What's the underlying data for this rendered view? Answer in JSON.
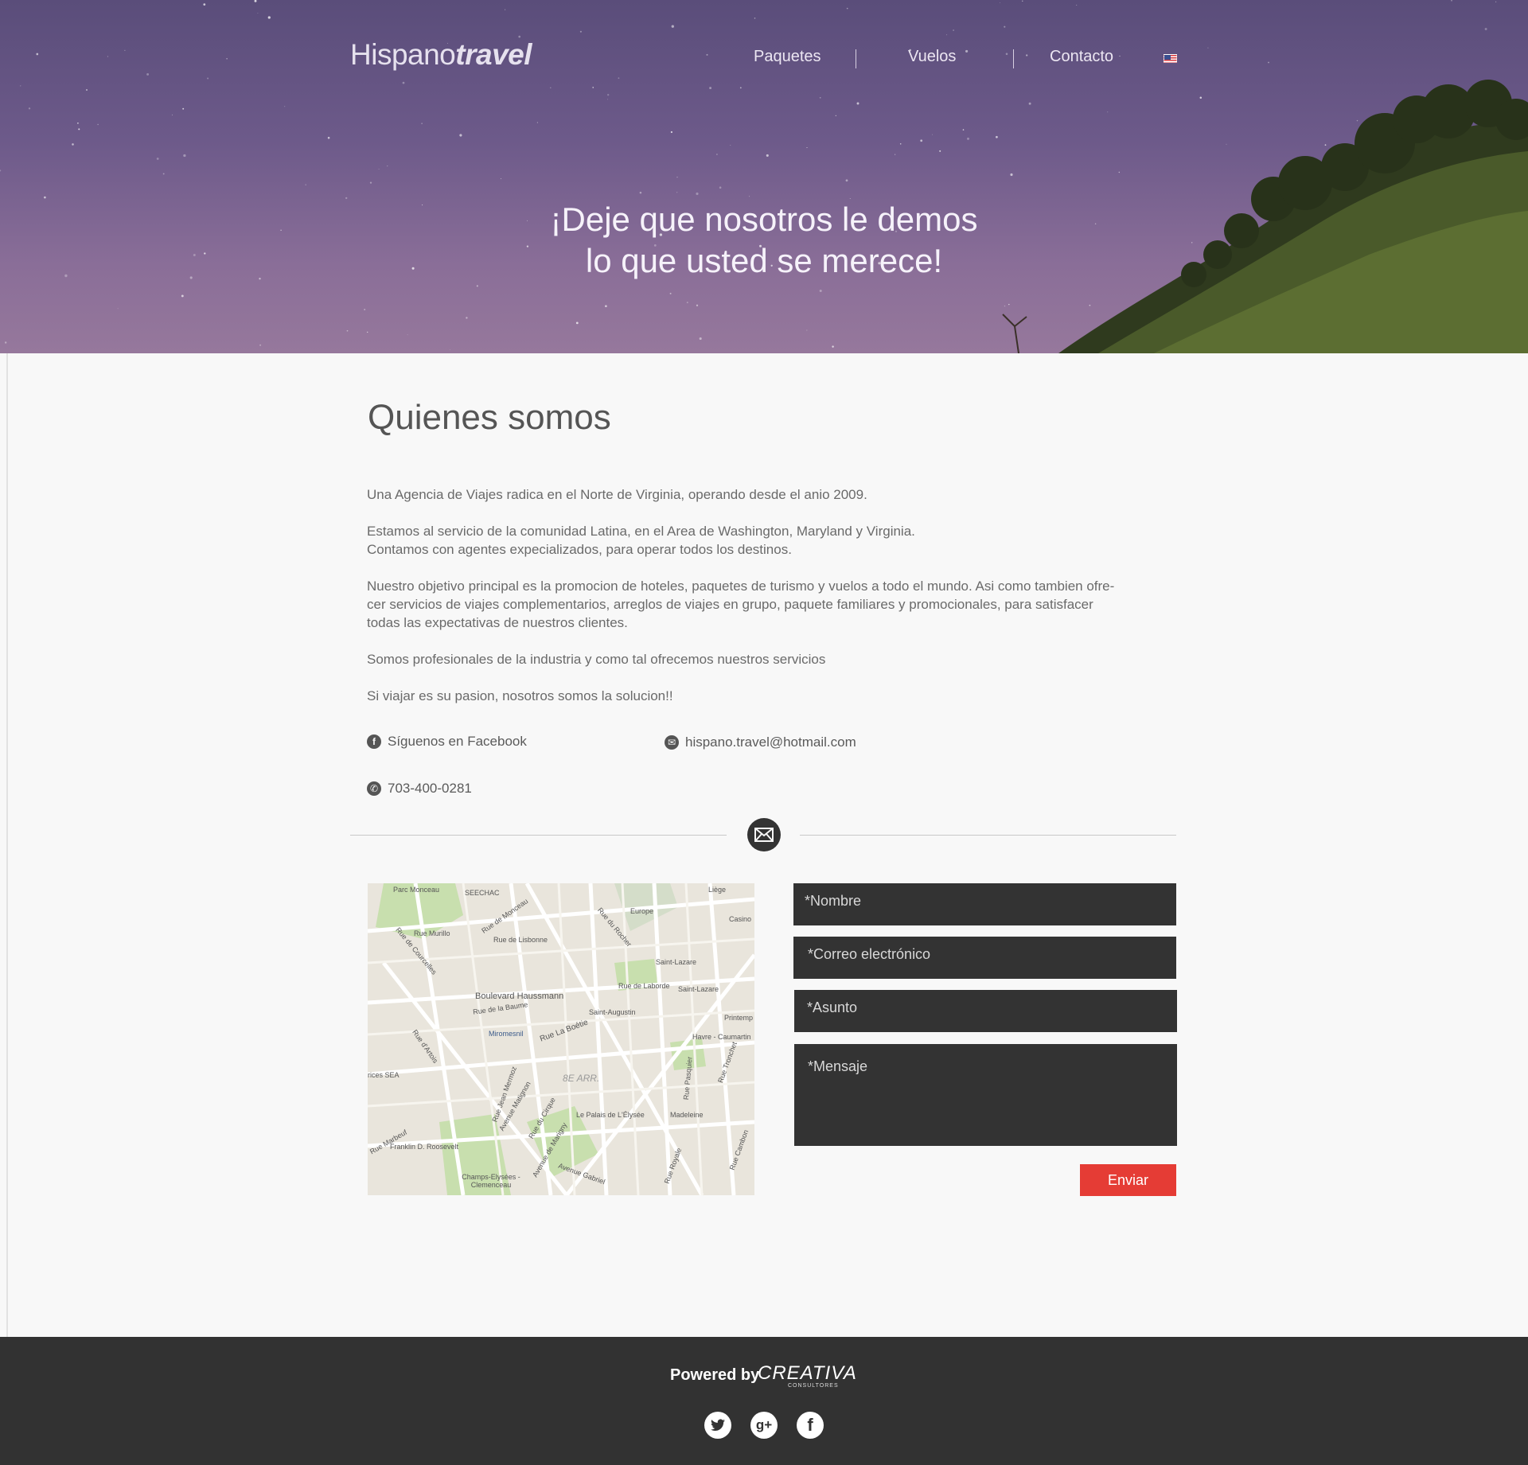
{
  "brand": {
    "name_light": "Hispano",
    "name_bold": "travel"
  },
  "nav": {
    "items": [
      "Paquetes",
      "Vuelos",
      "Contacto"
    ],
    "language_flag_icon": "us-flag-icon"
  },
  "hero": {
    "line1": "¡Deje que nosotros le demos",
    "line2": "lo que usted se merece!"
  },
  "about": {
    "title": "Quienes somos",
    "paragraphs": [
      "Una Agencia de Viajes radica en el Norte de Virginia, operando desde el anio 2009.",
      "Estamos al  servicio de la comunidad Latina, en el Area de Washington, Maryland y Virginia.",
      "Contamos con agentes expecializados, para operar todos los destinos.",
      "Nuestro objetivo principal es la promocion de hoteles, paquetes de turismo y vuelos a todo el mundo. Asi como tambien ofre-",
      "cer servicios de viajes complementarios, arreglos de viajes en grupo, paquete familiares y promocionales, para satisfacer",
      "todas las expectativas de nuestros clientes.",
      "Somos profesionales de la industria y como tal ofrecemos nuestros servicios",
      "Si viajar es su pasion, nosotros somos la solucion!!"
    ]
  },
  "contact": {
    "facebook": "Síguenos en Facebook",
    "email": "hispano.travel@hotmail.com",
    "phone": "703-400-0281"
  },
  "map": {
    "labels": [
      "Parc Monceau",
      "SEECHAC",
      "Liège",
      "Europe",
      "Casino",
      "Rue Murillo",
      "Rue de Lisbonne",
      "Rue de Monceau",
      "Rue de Courcelles",
      "Rue du Rocher",
      "Saint-Lazare",
      "Rue de Laborde",
      "Saint-Lazare",
      "Boulevard Haussmann",
      "Rue de la Baume",
      "Saint-Augustin",
      "Printemp",
      "Miromesnil",
      "Rue La Boétie",
      "Havre - Caumartin",
      "Rue d'Artois",
      "8E ARR.",
      "rices SEA",
      "Rue Jean Mermoz",
      "Avenue Matignon",
      "Rue du Cirque",
      "Le Palais de L'Élysée",
      "Madeleine",
      "Rue Marbeuf",
      "Franklin D. Roosevelt",
      "Avenue de Marigny",
      "Avenue Gabriel",
      "Champs-Elysées - Clemenceau",
      "Rue Royale",
      "Rue Cambon",
      "Rue Tronchet",
      "Rue Pasquier"
    ]
  },
  "form": {
    "nombre": "*Nombre",
    "correo": "*Correo electrónico",
    "asunto": "*Asunto",
    "mensaje": "*Mensaje",
    "submit": "Enviar"
  },
  "footer": {
    "powered_by": "Powered by",
    "company": "CREATIVA",
    "company_sub": "CONSULTORES",
    "social_icons": [
      "twitter-icon",
      "google-plus-icon",
      "facebook-icon"
    ]
  },
  "colors": {
    "hero": "#6d5a8a",
    "accent": "#e53c35",
    "dark": "#333333",
    "footer": "#323232"
  }
}
